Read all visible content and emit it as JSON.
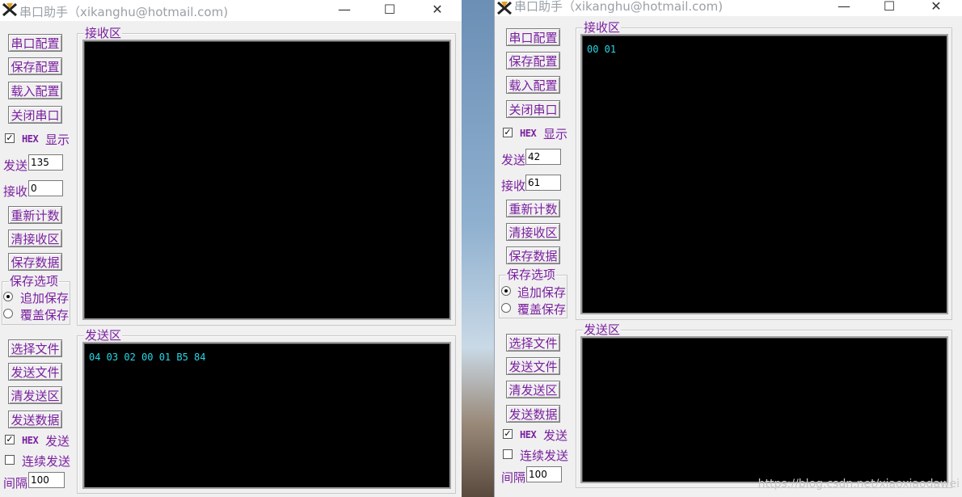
{
  "window_title": "串口助手（xikanghu@hotmail.com)",
  "titlebar_controls": {
    "minimize": "—",
    "maximize": "☐",
    "close": "✕"
  },
  "buttons": {
    "serial_config": "串口配置",
    "save_config": "保存配置",
    "load_config": "载入配置",
    "close_port": "关闭串口",
    "reset_count": "重新计数",
    "clear_receive": "清接收区",
    "save_data": "保存数据",
    "select_file": "选择文件",
    "send_file": "发送文件",
    "clear_send": "清发送区",
    "send_data": "发送数据"
  },
  "labels": {
    "hex": "HEX",
    "display": "显示",
    "send_word": "发送",
    "send_count": "发送",
    "recv_count": "接收",
    "save_options": "保存选项",
    "append_save": "追加保存",
    "overwrite_save": "覆盖保存",
    "continuous_send": "连续发送",
    "interval": "间隔",
    "receive_area": "接收区",
    "send_area": "发送区"
  },
  "win1": {
    "send_count": "135",
    "recv_count": "0",
    "interval": "100",
    "receive_text": "",
    "send_text": "04 03 02 00 01 B5 84"
  },
  "win2": {
    "send_count": "42",
    "recv_count": "61",
    "interval": "100",
    "receive_text": "00 01",
    "send_text": ""
  },
  "watermark": "https://blog.csdn.net/xiaoxiaodawei",
  "colors": {
    "label": "#7a1fa0",
    "screen_bg": "#000000",
    "screen_text": "#27d8e6"
  }
}
